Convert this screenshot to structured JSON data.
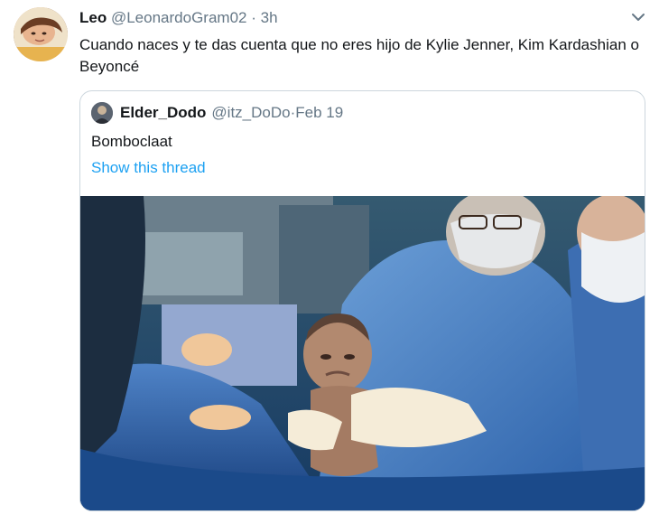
{
  "tweet": {
    "name": "Leo",
    "handle": "@LeonardoGram02",
    "separator": "·",
    "time": "3h",
    "text": "Cuando naces y te das cuenta que no eres hijo de Kylie Jenner, Kim Kardashian o Beyoncé",
    "caret_icon": "chevron-down-icon"
  },
  "quote": {
    "name": "Elder_Dodo",
    "handle": "@itz_DoDo",
    "separator": "·",
    "date": "Feb 19",
    "text": "Bomboclaat",
    "thread_link": "Show this thread",
    "link_color": "#1da1f2",
    "photo_icon": "newborn-photo"
  }
}
